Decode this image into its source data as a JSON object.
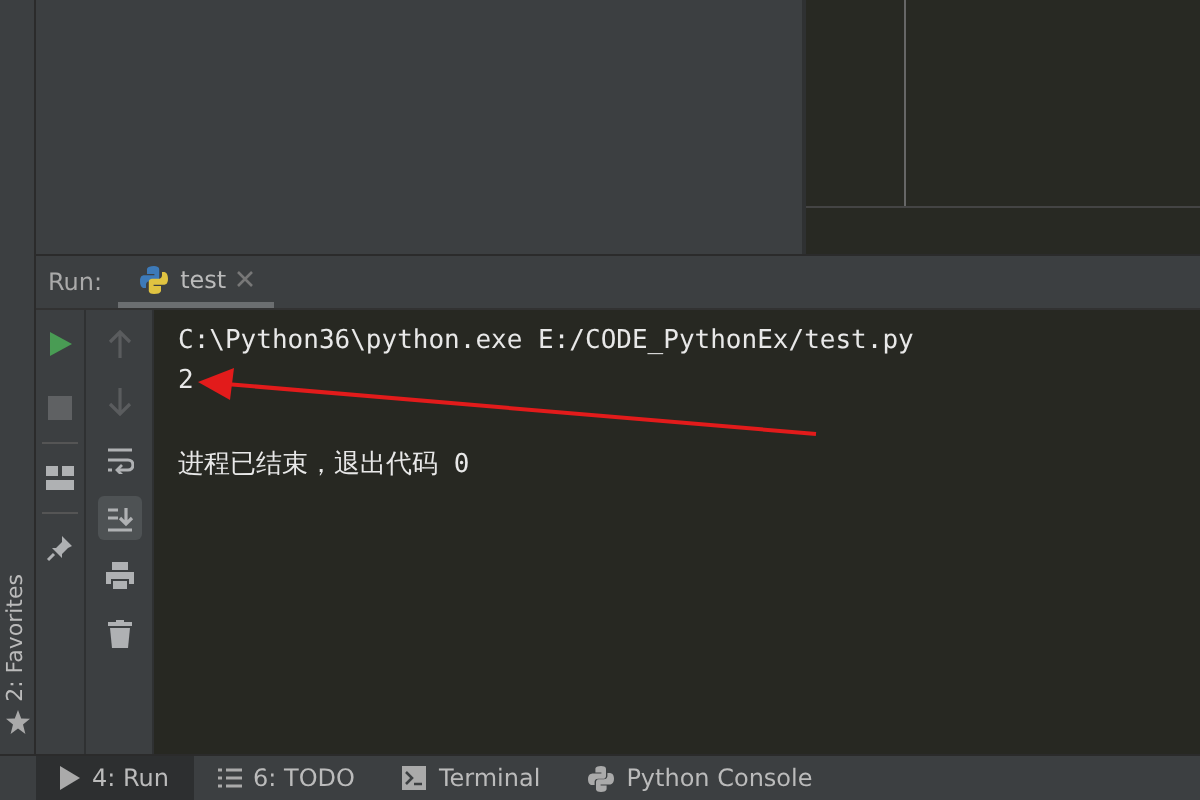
{
  "favorites_bar": {
    "label": "2: Favorites"
  },
  "run_panel": {
    "title": "Run:",
    "tabs": [
      {
        "label": "test",
        "selected": true
      }
    ],
    "main_toolbar": [
      {
        "kind": "run",
        "enabled": true
      },
      {
        "kind": "stop",
        "enabled": false
      },
      {
        "kind": "layout",
        "enabled": true
      },
      {
        "kind": "pin",
        "enabled": true
      }
    ],
    "side_toolbar": [
      {
        "kind": "up",
        "enabled": false,
        "selected": false
      },
      {
        "kind": "down",
        "enabled": false,
        "selected": false
      },
      {
        "kind": "wrap",
        "enabled": true,
        "selected": false
      },
      {
        "kind": "scroll-end",
        "enabled": true,
        "selected": true
      },
      {
        "kind": "print",
        "enabled": true,
        "selected": false
      },
      {
        "kind": "trash",
        "enabled": true,
        "selected": false
      }
    ],
    "console_lines": [
      {
        "text": "C:\\Python36\\python.exe E:/CODE_PythonEx/test.py",
        "kind": "command"
      },
      {
        "text": "2",
        "kind": "output"
      },
      {
        "text": "进程已结束，退出代码 0",
        "kind": "status"
      }
    ]
  },
  "tool_tabs": [
    {
      "label": "4: Run",
      "kind": "run",
      "selected": true
    },
    {
      "label": "6: TODO",
      "kind": "todo",
      "selected": false
    },
    {
      "label": "Terminal",
      "kind": "terminal",
      "selected": false
    },
    {
      "label": "Python Console",
      "kind": "python",
      "selected": false
    }
  ]
}
